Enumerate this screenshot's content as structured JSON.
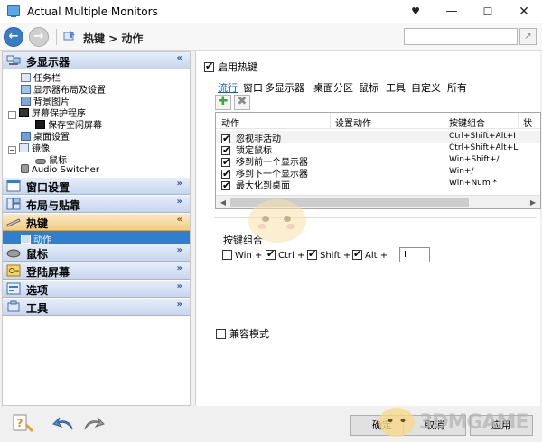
{
  "window": {
    "title": "Actual Multiple Monitors",
    "controls": {
      "pin": "♥",
      "minimize": "—",
      "maximize": "☐",
      "close": "✕"
    }
  },
  "nav": {
    "back_icon": "←",
    "forward_icon": "→",
    "breadcrumb": "热键 > 动作",
    "search_value": "",
    "search_btn": "↗"
  },
  "sidebar": {
    "sections": [
      {
        "label": "多显示器",
        "state": "expanded"
      },
      {
        "label": "窗口设置",
        "state": "collapsed"
      },
      {
        "label": "布局与贴靠",
        "state": "collapsed"
      },
      {
        "label": "热键",
        "state": "expanded"
      },
      {
        "label": "鼠标",
        "state": "collapsed"
      },
      {
        "label": "登陆屏幕",
        "state": "collapsed"
      },
      {
        "label": "选项",
        "state": "collapsed"
      },
      {
        "label": "工具",
        "state": "collapsed"
      }
    ],
    "multi_items": [
      "任务栏",
      "显示器布局及设置",
      "背景图片",
      "屏幕保护程序",
      "保存空闲屏幕",
      "桌面设置",
      "镜像",
      "鼠标",
      "Audio Switcher"
    ],
    "hotkey_items": [
      "动作"
    ],
    "chevron_expanded": "«",
    "chevron_collapsed": "»"
  },
  "main": {
    "enable_hotkeys": {
      "label": "启用热键",
      "checked": true
    },
    "tabs": [
      "流行",
      "窗口",
      "多显示器",
      "桌面分区",
      "鼠标",
      "工具",
      "自定义",
      "所有"
    ],
    "add_icon": "✚",
    "delete_icon": "✖",
    "columns": [
      "动作",
      "设置动作",
      "按键组合",
      "状"
    ],
    "rows": [
      {
        "action": "忽视非活动",
        "combo": "Ctrl+Shift+Alt+I",
        "checked": true
      },
      {
        "action": "锁定鼠标",
        "combo": "Ctrl+Shift+Alt+L",
        "checked": true
      },
      {
        "action": "移到前一个显示器",
        "combo": "Win+Shift+/",
        "checked": true
      },
      {
        "action": "移到下一个显示器",
        "combo": "Win+/",
        "checked": true
      },
      {
        "action": "最大化到桌面",
        "combo": "Win+Num *",
        "checked": true
      }
    ],
    "key_combo": {
      "title": "按键组合",
      "win": {
        "label": "Win +",
        "checked": false
      },
      "ctrl": {
        "label": "Ctrl +",
        "checked": true
      },
      "shift": {
        "label": "Shift +",
        "checked": true
      },
      "alt": {
        "label": "Alt +",
        "checked": true
      },
      "key_value": "I"
    },
    "compat_mode": {
      "label": "兼容模式",
      "checked": false
    }
  },
  "footer": {
    "ok": "确定",
    "cancel": "取消",
    "apply": "应用",
    "watermark": "3DMGAME"
  }
}
